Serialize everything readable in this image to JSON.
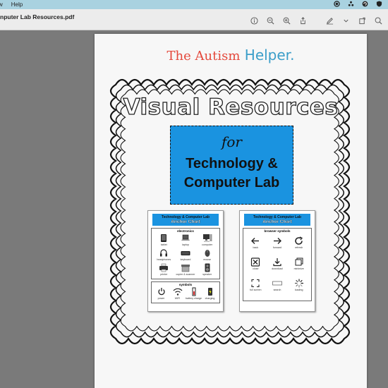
{
  "menubar": {
    "items": [
      "w",
      "Help"
    ]
  },
  "window": {
    "title": "nputer Lab Resources.pdf"
  },
  "toolbar": {
    "icons": [
      "info-icon",
      "zoom-out-icon",
      "zoom-in-icon",
      "share-icon",
      "markup-icon",
      "chevron-down-icon",
      "rotate-icon",
      "search-icon"
    ]
  },
  "document": {
    "brand_part1": "The Autism",
    "brand_part2": "Helper.",
    "heading": "Visual Resources",
    "for": "for",
    "subtitle_line1": "Technology &",
    "subtitle_line2": "Computer Lab",
    "card_left": {
      "title": "Technology & Computer Lab",
      "subtitle": "Anchor Chart",
      "section1": "electronics",
      "items1": [
        "tablet",
        "laptop",
        "computer",
        "headphones",
        "keyboard",
        "mouse",
        "printer",
        "copier & scanner",
        "speaker"
      ],
      "section2": "symbols",
      "items2": [
        "power",
        "WIFI",
        "battery charge",
        "charging"
      ]
    },
    "card_right": {
      "title": "Technology & Computer Lab",
      "subtitle": "Anchor Chart",
      "section1": "browser symbols",
      "items1": [
        "back",
        "forward",
        "refresh",
        "close",
        "download",
        "minimize",
        "full screen",
        "search",
        "loading"
      ]
    }
  }
}
